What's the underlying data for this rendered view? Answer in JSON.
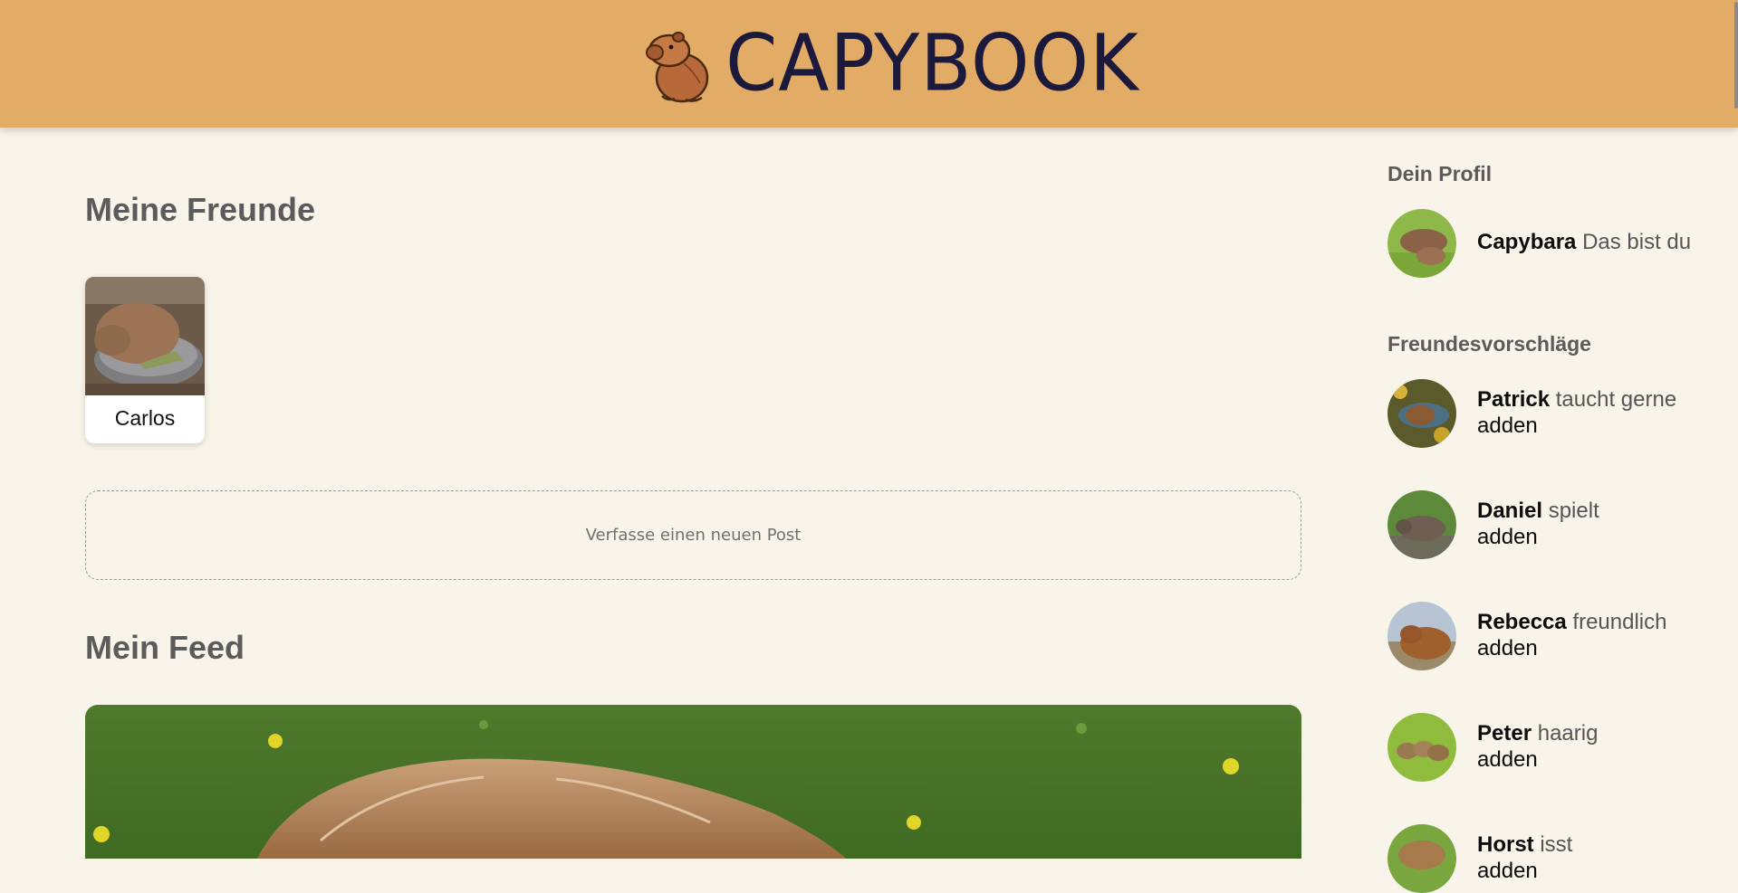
{
  "header": {
    "title": "CAPYBOOK",
    "logo_icon": "capybara-logo-icon",
    "background_color": "#e2ab66",
    "title_color": "#1c1a3c"
  },
  "friends": {
    "heading": "Meine Freunde",
    "items": [
      {
        "name": "Carlos",
        "photo_icon": "capybara-in-bowl-photo"
      }
    ]
  },
  "composer": {
    "placeholder": "Verfasse einen neuen Post"
  },
  "feed": {
    "heading": "Mein Feed",
    "posts": [
      {
        "image": "capybara-on-grass-photo"
      }
    ]
  },
  "profile": {
    "heading": "Dein Profil",
    "name": "Capybara",
    "description": "Das bist du"
  },
  "suggestions": {
    "heading": "Freundesvorschläge",
    "add_label": "adden",
    "items": [
      {
        "name": "Patrick",
        "description": "taucht gerne"
      },
      {
        "name": "Daniel",
        "description": "spielt"
      },
      {
        "name": "Rebecca",
        "description": "freundlich"
      },
      {
        "name": "Peter",
        "description": "haarig"
      },
      {
        "name": "Horst",
        "description": "isst"
      }
    ]
  },
  "colors": {
    "page_background": "#f8f4e9",
    "heading_text": "#5b5b5b"
  }
}
